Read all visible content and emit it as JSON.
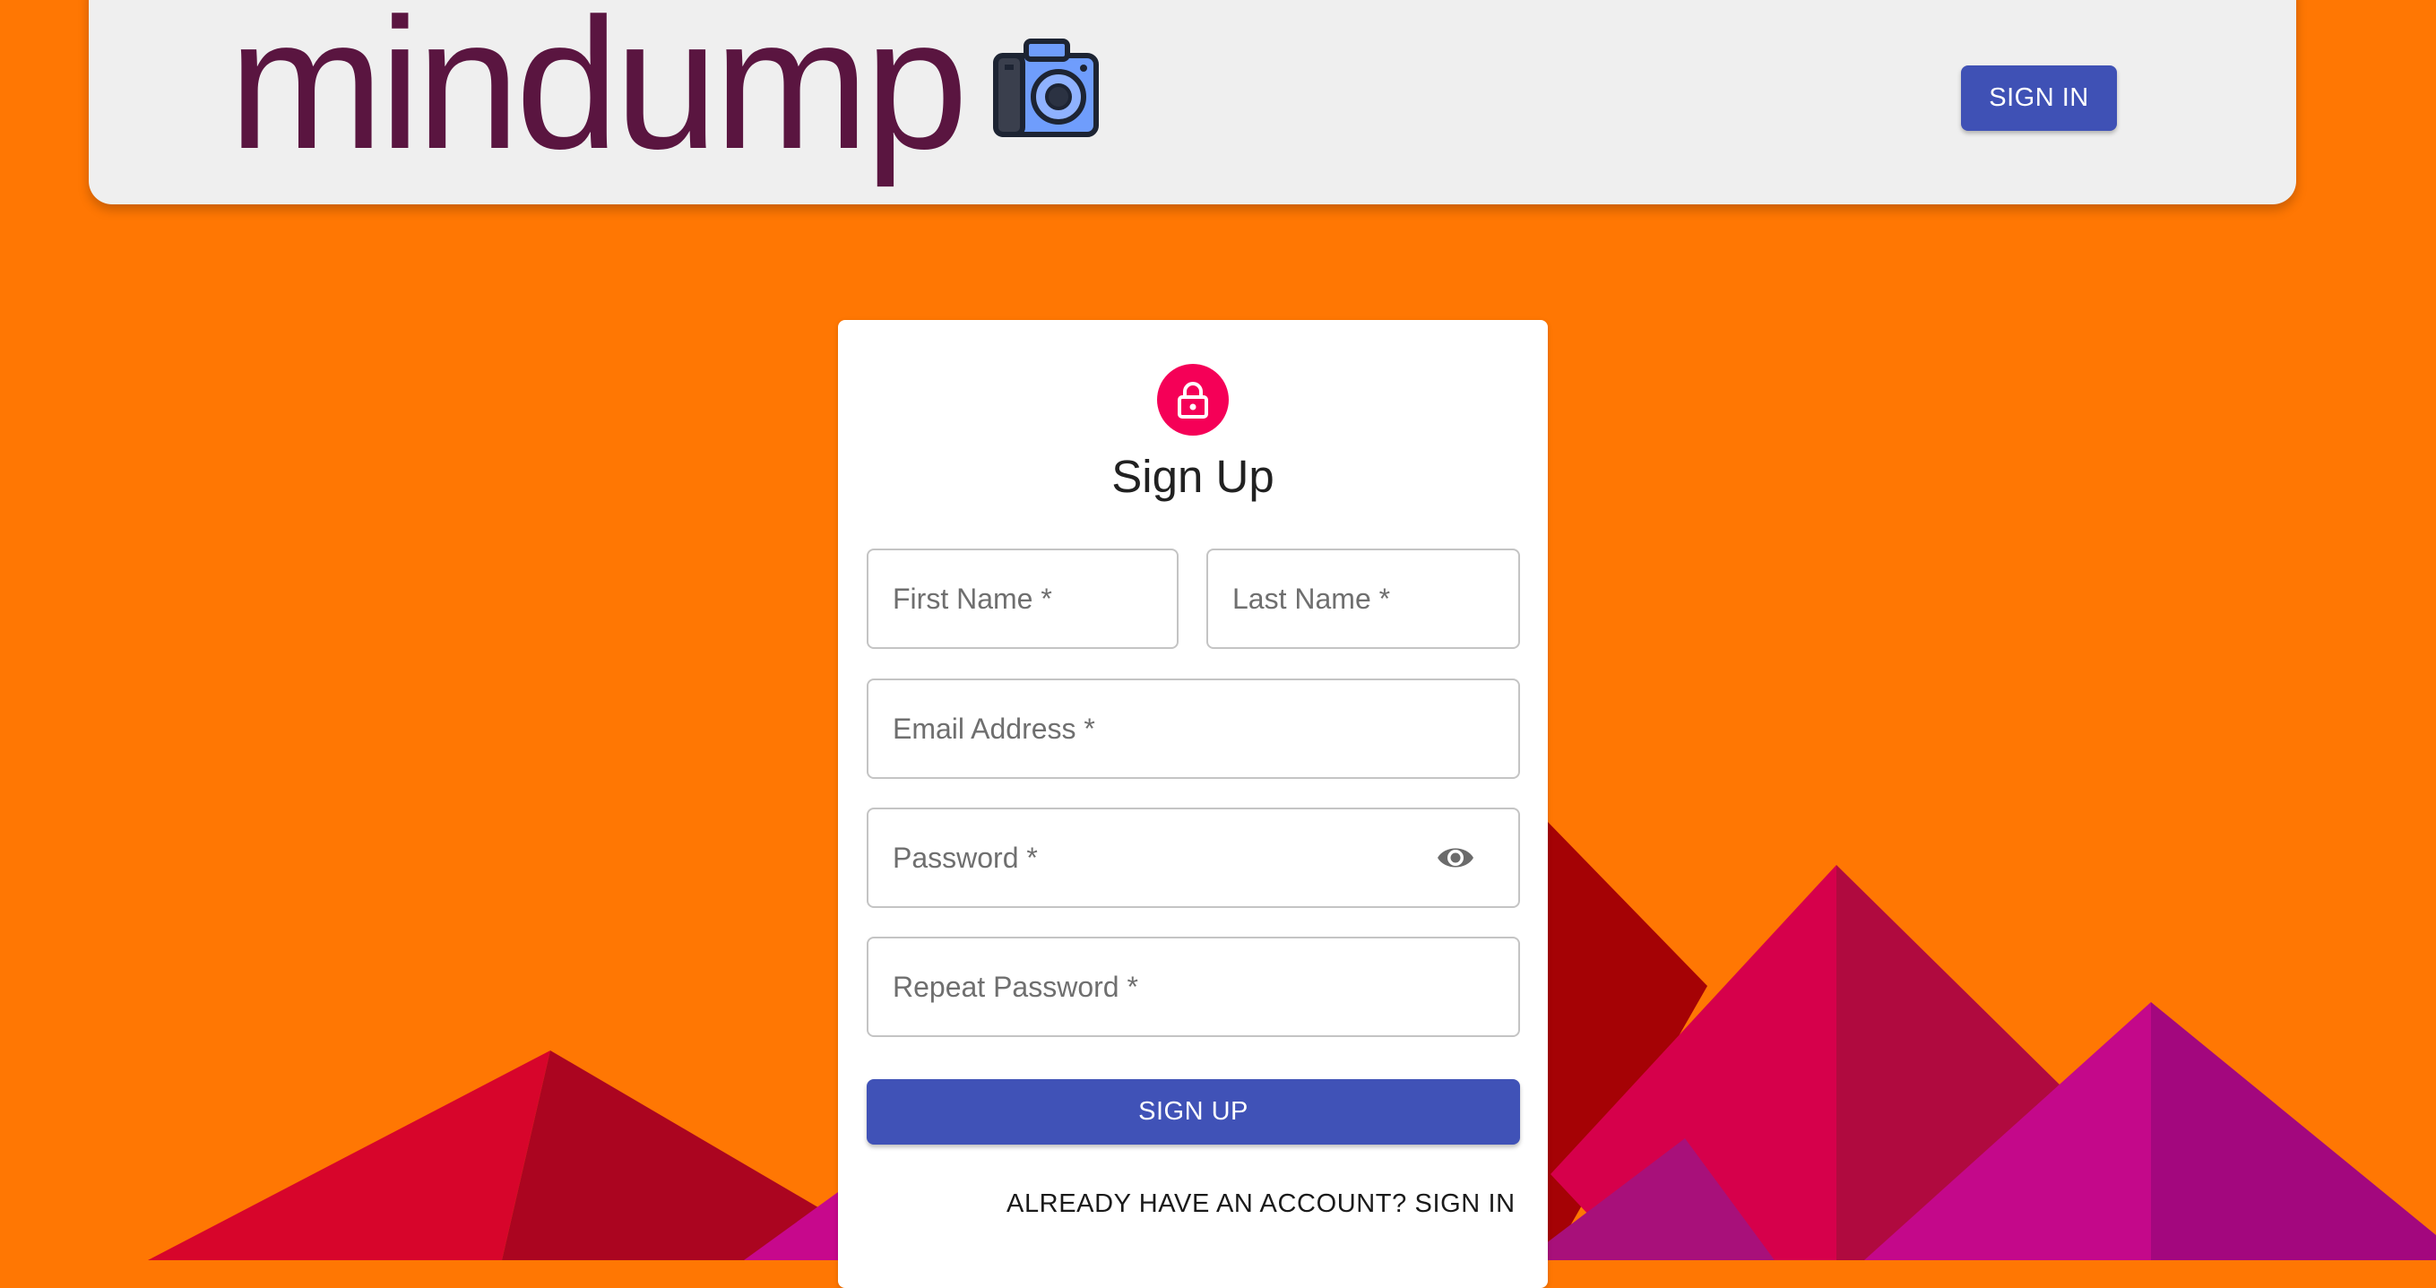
{
  "header": {
    "brand_name": "mindump",
    "logo_icon": "camera-icon",
    "signin_label": "SIGN IN"
  },
  "form": {
    "icon": "lock-icon",
    "title": "Sign Up",
    "first_name_label": "First Name *",
    "last_name_label": "Last Name *",
    "email_label": "Email Address *",
    "password_label": "Password *",
    "password_toggle_icon": "eye-icon",
    "repeat_password_label": "Repeat Password *",
    "submit_label": "SIGN UP",
    "signin_link_label": "ALREADY HAVE AN ACCOUNT? SIGN IN"
  },
  "colors": {
    "background": "#ff7703",
    "primary": "#3f51b5",
    "accent": "#f50057",
    "brand_text": "#5a1540"
  }
}
